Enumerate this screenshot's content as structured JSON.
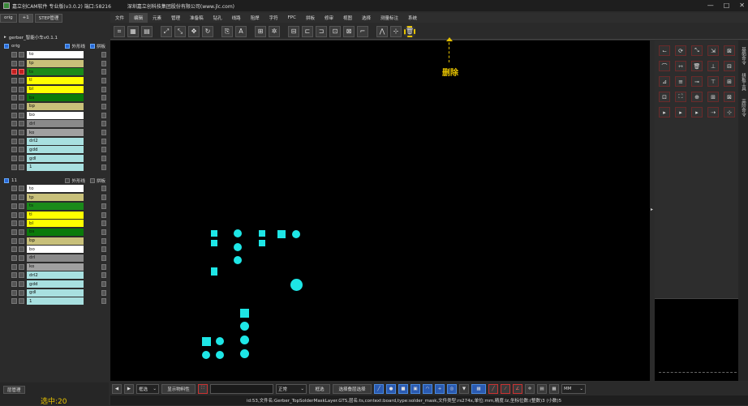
{
  "window": {
    "title": "嘉立创CAM软件 专业版(v3.0.2) 端口:58216",
    "company": "深圳嘉立创科技集团股份有限公司(www.jlc.com)",
    "controls": [
      "—",
      "□",
      "✕"
    ]
  },
  "left_tabs": [
    "orig",
    "+1",
    "STEP管理"
  ],
  "menu": [
    "文件",
    "编辑",
    "元素",
    "管理",
    "准备稿",
    "钻孔",
    "线路",
    "阻焊",
    "字符",
    "FPC",
    "拼板",
    "修审",
    "视图",
    "选择",
    "测量标注",
    "系统"
  ],
  "menu_active": 1,
  "job_title": "gerber_智能小车v0.1.1",
  "steps": [
    {
      "name": "orig",
      "opt1": "外形线",
      "opt1_on": true,
      "opt2": "拼板",
      "opt2_on": true,
      "layers": [
        {
          "name": "to",
          "color": "#ffffff"
        },
        {
          "name": "tp",
          "color": "#c8c07a"
        },
        {
          "name": "ts",
          "color": "#1a8a1a"
        },
        {
          "name": "tl",
          "color": "#ffff00"
        },
        {
          "name": "bl",
          "color": "#ffff00"
        },
        {
          "name": "bs",
          "color": "#0a7a0a"
        },
        {
          "name": "bp",
          "color": "#c8c07a"
        },
        {
          "name": "bo",
          "color": "#ffffff"
        },
        {
          "name": "drl",
          "color": "#8a8a8a"
        },
        {
          "name": "ko",
          "color": "#a0a0a0"
        },
        {
          "name": "drl2",
          "color": "#a8e0e0"
        },
        {
          "name": "gdd",
          "color": "#a8e0e0"
        },
        {
          "name": "gdl",
          "color": "#a8e0e0"
        },
        {
          "name": "1",
          "color": "#a8e0e0"
        }
      ]
    },
    {
      "name": "11",
      "opt1": "外形线",
      "opt1_on": false,
      "opt2": "拼板",
      "opt2_on": false,
      "layers": [
        {
          "name": "to",
          "color": "#ffffff"
        },
        {
          "name": "tp",
          "color": "#c8c07a"
        },
        {
          "name": "ts",
          "color": "#1a8a1a"
        },
        {
          "name": "tl",
          "color": "#ffff00"
        },
        {
          "name": "bl",
          "color": "#ffff00"
        },
        {
          "name": "bs",
          "color": "#0a7a0a"
        },
        {
          "name": "bp",
          "color": "#c8c07a"
        },
        {
          "name": "bo",
          "color": "#ffffff"
        },
        {
          "name": "drl",
          "color": "#8a8a8a"
        },
        {
          "name": "ko",
          "color": "#a0a0a0"
        },
        {
          "name": "drl2",
          "color": "#a8e0e0"
        },
        {
          "name": "gdd",
          "color": "#a8e0e0"
        },
        {
          "name": "gdl",
          "color": "#a8e0e0"
        },
        {
          "name": "1",
          "color": "#a8e0e0"
        }
      ]
    }
  ],
  "layer_manager": "层管理",
  "selected_count": "选中:20",
  "annotation": "删除",
  "bottom": {
    "filter": "框选",
    "show_btn": "显示物料性",
    "mode": "正常",
    "sel_a": "框选",
    "sel_b": "选择叠层选择",
    "units": "MM"
  },
  "status": "id:53,文件名:Gerber_TopSolderMaskLayer.GTS,层名:ts,context:board,type:solder_mask,文件类型:rs274x,单位:mm,精度:lz,坐标位数:(整数)3 (小数)5",
  "right_strip_labels": [
    "基础命令",
    "拼板工具",
    "高阶命令"
  ]
}
